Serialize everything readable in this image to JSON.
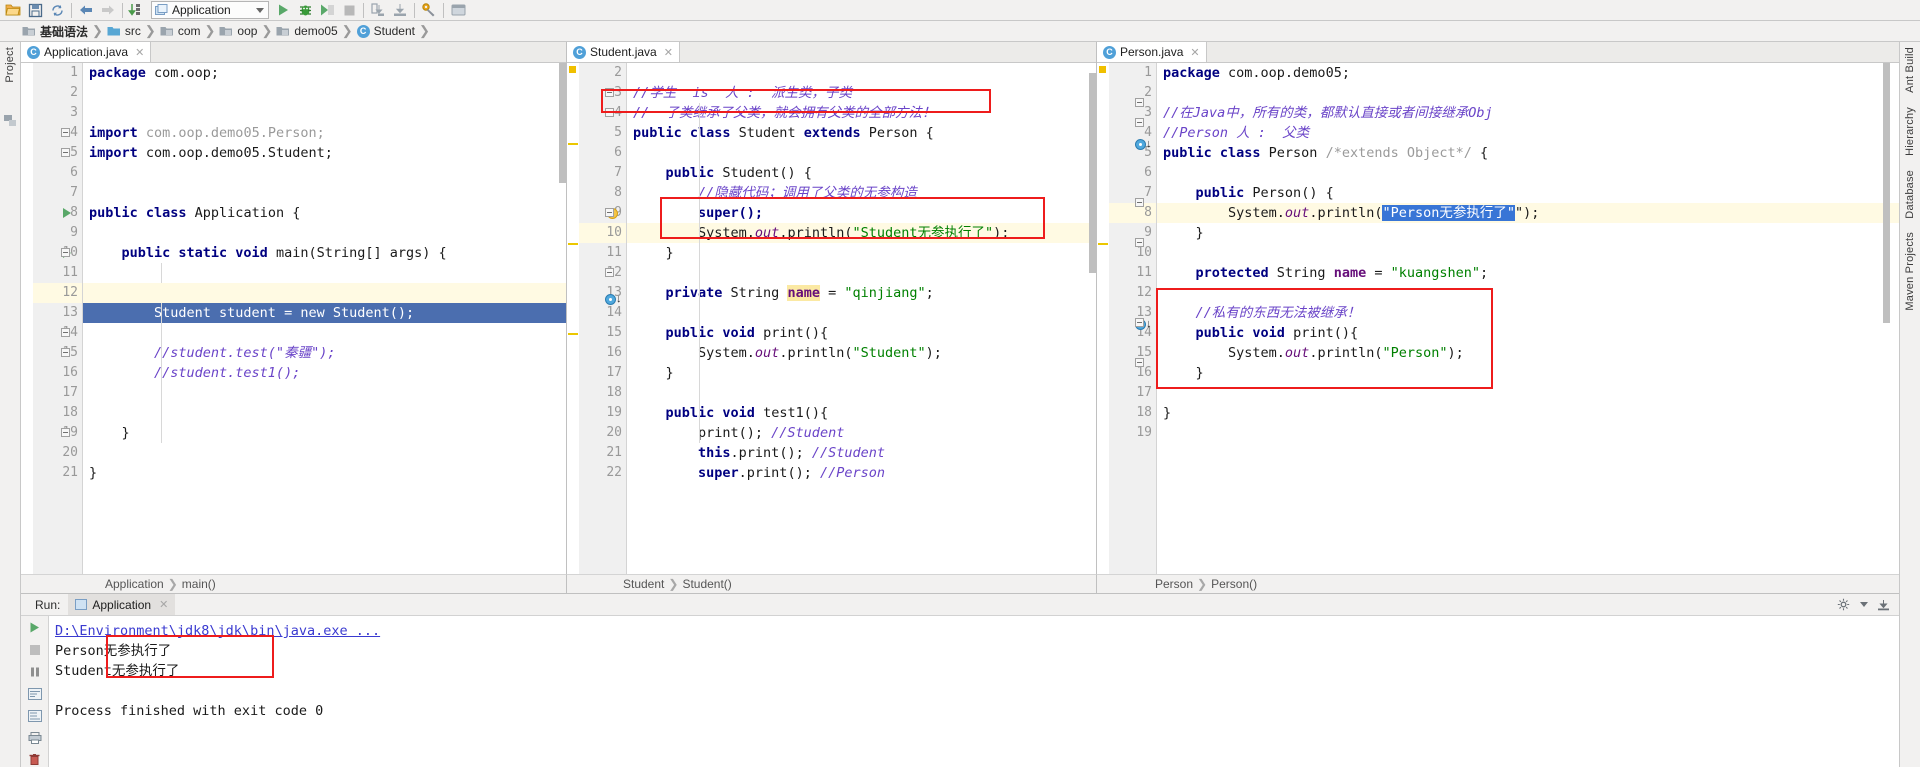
{
  "toolbar": {
    "icons": [
      "open-folder-icon",
      "save-all-icon",
      "sync-icon",
      "back-icon",
      "forward-icon",
      "compile-icon"
    ],
    "run_config": {
      "name": "Application",
      "dropdown": "chevron-down-icon"
    },
    "actions": [
      "run-icon",
      "debug-icon",
      "run-coverage-icon",
      "stop-icon",
      "update-app-icon",
      "download-icon",
      "settings-icon",
      "help-icon"
    ]
  },
  "navbar": {
    "crumbs": [
      {
        "label": "基础语法",
        "icon": "module-icon",
        "bold": true
      },
      {
        "label": "src",
        "icon": "folder-icon",
        "bold": false
      },
      {
        "label": "com",
        "icon": "package-icon",
        "bold": false
      },
      {
        "label": "oop",
        "icon": "package-icon",
        "bold": false
      },
      {
        "label": "demo05",
        "icon": "package-icon",
        "bold": false
      },
      {
        "label": "Student",
        "icon": "class-icon",
        "bold": false
      }
    ]
  },
  "left_rail": {
    "label": "Project",
    "icon": "structure-icon"
  },
  "right_rail": {
    "items": [
      "Ant Build",
      "Hierarchy",
      "Database",
      "Maven Projects"
    ]
  },
  "editors": [
    {
      "tab": {
        "label": "Application.java",
        "icon": "class-icon",
        "close": "✕"
      },
      "breadcrumb": [
        "Application",
        "main()"
      ],
      "first_line": 1,
      "lines": [
        {
          "n": 1,
          "tokens": [
            {
              "t": "package ",
              "c": "kw"
            },
            {
              "t": "com.oop;",
              "c": "plain"
            }
          ],
          "indent": 0
        },
        {
          "n": 2,
          "tokens": []
        },
        {
          "n": 3,
          "tokens": []
        },
        {
          "n": 4,
          "tokens": [
            {
              "t": "import ",
              "c": "kw"
            },
            {
              "t": "com.oop.demo05.Person;",
              "c": "grey"
            }
          ]
        },
        {
          "n": 5,
          "tokens": [
            {
              "t": "import ",
              "c": "kw"
            },
            {
              "t": "com.oop.demo05.Student;",
              "c": "plain"
            }
          ]
        },
        {
          "n": 6,
          "tokens": []
        },
        {
          "n": 7,
          "tokens": []
        },
        {
          "n": 8,
          "tokens": [
            {
              "t": "public class ",
              "c": "kw"
            },
            {
              "t": "Application {",
              "c": "plain"
            }
          ]
        },
        {
          "n": 9,
          "tokens": []
        },
        {
          "n": 10,
          "tokens": [
            {
              "t": "    ",
              "c": "plain"
            },
            {
              "t": "public static void ",
              "c": "kw"
            },
            {
              "t": "main(String[] args) {",
              "c": "plain"
            }
          ]
        },
        {
          "n": 11,
          "tokens": []
        },
        {
          "n": 12,
          "tokens": []
        },
        {
          "n": 13,
          "tokens": [
            {
              "t": "        Student student = ",
              "c": "sel-text"
            },
            {
              "t": "new ",
              "c": "sel-text"
            },
            {
              "t": "Student();",
              "c": "sel-text"
            }
          ]
        },
        {
          "n": 14,
          "tokens": []
        },
        {
          "n": 15,
          "tokens": [
            {
              "t": "        //student.test(\"秦疆\");",
              "c": "cmt"
            }
          ]
        },
        {
          "n": 16,
          "tokens": [
            {
              "t": "        //student.test1();",
              "c": "cmt"
            }
          ]
        },
        {
          "n": 17,
          "tokens": []
        },
        {
          "n": 18,
          "tokens": []
        },
        {
          "n": 19,
          "tokens": [
            {
              "t": "    }",
              "c": "plain"
            }
          ]
        },
        {
          "n": 20,
          "tokens": []
        },
        {
          "n": 21,
          "tokens": [
            {
              "t": "}",
              "c": "plain"
            }
          ]
        }
      ]
    },
    {
      "tab": {
        "label": "Student.java",
        "icon": "class-icon",
        "close": "✕"
      },
      "breadcrumb": [
        "Student",
        "Student()"
      ],
      "first_line": 2,
      "lines": [
        {
          "n": 2,
          "tokens": []
        },
        {
          "n": 3,
          "tokens": [
            {
              "t": "//学生  is  人 :  派生类，子类",
              "c": "cmt"
            }
          ]
        },
        {
          "n": 4,
          "tokens": [
            {
              "t": "//  子类继承了父类，就会拥有父类的全部方法！",
              "c": "cmt"
            }
          ]
        },
        {
          "n": 5,
          "tokens": [
            {
              "t": "public class ",
              "c": "kw"
            },
            {
              "t": "Student ",
              "c": "plain"
            },
            {
              "t": "extends ",
              "c": "kw"
            },
            {
              "t": "Person {",
              "c": "plain"
            }
          ]
        },
        {
          "n": 6,
          "tokens": []
        },
        {
          "n": 7,
          "tokens": [
            {
              "t": "    ",
              "c": "plain"
            },
            {
              "t": "public ",
              "c": "kw"
            },
            {
              "t": "Student() {",
              "c": "plain"
            }
          ]
        },
        {
          "n": 8,
          "tokens": [
            {
              "t": "        //隐藏代码；调用了父类的无参构造",
              "c": "cmt"
            }
          ]
        },
        {
          "n": 9,
          "tokens": [
            {
              "t": "        super();",
              "c": "kwsuper"
            }
          ]
        },
        {
          "n": 10,
          "tokens": [
            {
              "t": "        System.",
              "c": "plain"
            },
            {
              "t": "out",
              "c": "statfld"
            },
            {
              "t": ".println(",
              "c": "plain"
            },
            {
              "t": "\"Student无参执行了\"",
              "c": "str"
            },
            {
              "t": ");",
              "c": "plain"
            }
          ]
        },
        {
          "n": 11,
          "tokens": [
            {
              "t": "    }",
              "c": "plain"
            }
          ]
        },
        {
          "n": 12,
          "tokens": []
        },
        {
          "n": 13,
          "tokens": [
            {
              "t": "    ",
              "c": "plain"
            },
            {
              "t": "private ",
              "c": "kw"
            },
            {
              "t": "String ",
              "c": "plain"
            },
            {
              "t": "name",
              "c": "occur-field"
            },
            {
              "t": " = ",
              "c": "plain"
            },
            {
              "t": "\"qinjiang\"",
              "c": "str"
            },
            {
              "t": ";",
              "c": "plain"
            }
          ]
        },
        {
          "n": 14,
          "tokens": []
        },
        {
          "n": 15,
          "tokens": [
            {
              "t": "    ",
              "c": "plain"
            },
            {
              "t": "public void ",
              "c": "kw"
            },
            {
              "t": "print(){",
              "c": "plain"
            }
          ]
        },
        {
          "n": 16,
          "tokens": [
            {
              "t": "        System.",
              "c": "plain"
            },
            {
              "t": "out",
              "c": "statfld"
            },
            {
              "t": ".println(",
              "c": "plain"
            },
            {
              "t": "\"Student\"",
              "c": "str"
            },
            {
              "t": ");",
              "c": "plain"
            }
          ]
        },
        {
          "n": 17,
          "tokens": [
            {
              "t": "    }",
              "c": "plain"
            }
          ]
        },
        {
          "n": 18,
          "tokens": []
        },
        {
          "n": 19,
          "tokens": [
            {
              "t": "    ",
              "c": "plain"
            },
            {
              "t": "public void ",
              "c": "kw"
            },
            {
              "t": "test1(){",
              "c": "plain"
            }
          ]
        },
        {
          "n": 20,
          "tokens": [
            {
              "t": "        print(); ",
              "c": "plain"
            },
            {
              "t": "//Student",
              "c": "cmt"
            }
          ]
        },
        {
          "n": 21,
          "tokens": [
            {
              "t": "        ",
              "c": "plain"
            },
            {
              "t": "this",
              "c": "kw"
            },
            {
              "t": ".print(); ",
              "c": "plain"
            },
            {
              "t": "//Student",
              "c": "cmt"
            }
          ]
        },
        {
          "n": 22,
          "tokens": [
            {
              "t": "        ",
              "c": "plain"
            },
            {
              "t": "super",
              "c": "kw"
            },
            {
              "t": ".print(); ",
              "c": "plain"
            },
            {
              "t": "//Person",
              "c": "cmt"
            }
          ]
        }
      ]
    },
    {
      "tab": {
        "label": "Person.java",
        "icon": "class-icon",
        "close": "✕"
      },
      "breadcrumb": [
        "Person",
        "Person()"
      ],
      "first_line": 1,
      "lines": [
        {
          "n": 1,
          "tokens": [
            {
              "t": "package ",
              "c": "kw"
            },
            {
              "t": "com.oop.demo05;",
              "c": "plain"
            }
          ]
        },
        {
          "n": 2,
          "tokens": []
        },
        {
          "n": 3,
          "tokens": [
            {
              "t": "//在Java中，所有的类，都默认直接或者间接继承Obj",
              "c": "cmt"
            }
          ]
        },
        {
          "n": 4,
          "tokens": [
            {
              "t": "//Person 人 :  父类",
              "c": "cmt"
            }
          ]
        },
        {
          "n": 5,
          "tokens": [
            {
              "t": "public class ",
              "c": "kw"
            },
            {
              "t": "Person ",
              "c": "plain"
            },
            {
              "t": "/*extends Object*/",
              "c": "grey"
            },
            {
              "t": " {",
              "c": "plain"
            }
          ]
        },
        {
          "n": 6,
          "tokens": []
        },
        {
          "n": 7,
          "tokens": [
            {
              "t": "    ",
              "c": "plain"
            },
            {
              "t": "public ",
              "c": "kw"
            },
            {
              "t": "Person() {",
              "c": "plain"
            }
          ]
        },
        {
          "n": 8,
          "tokens": [
            {
              "t": "        System.",
              "c": "plain"
            },
            {
              "t": "out",
              "c": "statfld"
            },
            {
              "t": ".println(",
              "c": "plain"
            },
            {
              "t": "\"Person无参执行了\"",
              "c": "sel-str"
            },
            {
              "t": "\");",
              "c": "plain"
            }
          ]
        },
        {
          "n": 9,
          "tokens": [
            {
              "t": "    }",
              "c": "plain"
            }
          ]
        },
        {
          "n": 10,
          "tokens": []
        },
        {
          "n": 11,
          "tokens": [
            {
              "t": "    ",
              "c": "plain"
            },
            {
              "t": "protected ",
              "c": "kw"
            },
            {
              "t": "String ",
              "c": "plain"
            },
            {
              "t": "name",
              "c": "field"
            },
            {
              "t": " = ",
              "c": "plain"
            },
            {
              "t": "\"kuangshen\"",
              "c": "str"
            },
            {
              "t": ";",
              "c": "plain"
            }
          ]
        },
        {
          "n": 12,
          "tokens": []
        },
        {
          "n": 13,
          "tokens": [
            {
              "t": "    //私有的东西无法被继承！",
              "c": "cmt"
            }
          ]
        },
        {
          "n": 14,
          "tokens": [
            {
              "t": "    ",
              "c": "plain"
            },
            {
              "t": "public void ",
              "c": "kw"
            },
            {
              "t": "print(){",
              "c": "plain"
            }
          ]
        },
        {
          "n": 15,
          "tokens": [
            {
              "t": "        System.",
              "c": "plain"
            },
            {
              "t": "out",
              "c": "statfld"
            },
            {
              "t": ".println(",
              "c": "plain"
            },
            {
              "t": "\"Person\"",
              "c": "str"
            },
            {
              "t": ");",
              "c": "plain"
            }
          ]
        },
        {
          "n": 16,
          "tokens": [
            {
              "t": "    }",
              "c": "plain"
            }
          ]
        },
        {
          "n": 17,
          "tokens": []
        },
        {
          "n": 18,
          "tokens": [
            {
              "t": "}",
              "c": "plain"
            }
          ]
        },
        {
          "n": 19,
          "tokens": []
        }
      ]
    }
  ],
  "run_panel": {
    "label": "Run:",
    "tab": {
      "label": "Application",
      "icon": "run-config-icon",
      "close": "✕"
    },
    "tools": [
      "rerun-icon",
      "stop-icon",
      "pause-icon",
      "trace-up-icon",
      "trace-down-icon",
      "soft-wrap-icon",
      "scroll-to-end-icon",
      "print-icon",
      "clear-all-icon"
    ],
    "header_right": [
      "settings-icon",
      "minimize-icon"
    ],
    "console": [
      {
        "text": "D:\\Environment\\jdk8\\jdk\\bin\\java.exe ...",
        "type": "command"
      },
      {
        "text": "Person无参执行了",
        "type": "output"
      },
      {
        "text": "Student无参执行了",
        "type": "output"
      },
      {
        "text": "",
        "type": "output"
      },
      {
        "text": "Process finished with exit code 0",
        "type": "output"
      }
    ]
  },
  "colors": {
    "accent_red": "#ee1c1c",
    "selection_blue": "#4b6eaf",
    "keyword": "#000080",
    "string": "#008000",
    "comment": "#6a44c8",
    "caret_row": "#fffae3",
    "run_green": "#59a869"
  }
}
